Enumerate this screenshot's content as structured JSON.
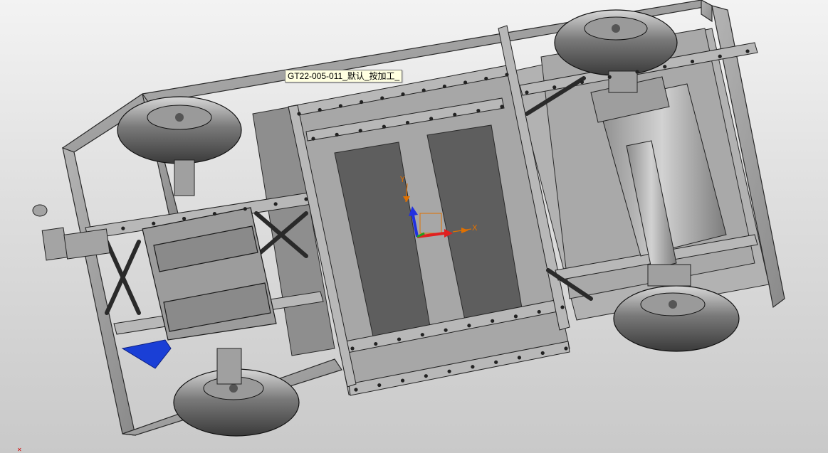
{
  "viewport": {
    "background_top": "#f3f3f3",
    "background_bottom": "#c9c9c9",
    "model_color": "#9a9a9a",
    "edge_color": "#2a2a2a",
    "highlight_color": "#1a3fd6"
  },
  "tooltip": {
    "text": "GT22-005-011_默认_按加工_"
  },
  "triad": {
    "x_label": "X",
    "y_label": "Y",
    "x_color": "#e02020",
    "y_color": "#20a020",
    "z_color": "#2030e0",
    "label_color": "#e07000"
  }
}
